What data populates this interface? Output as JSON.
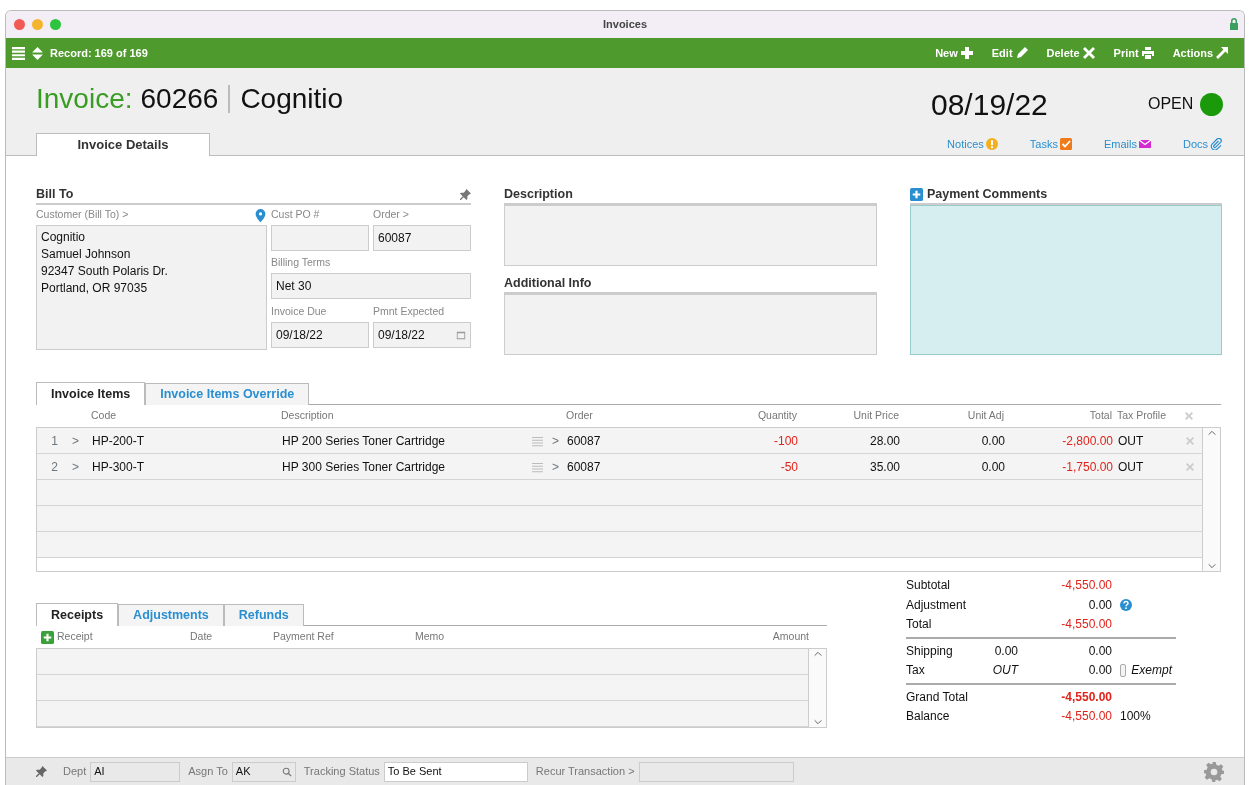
{
  "window": {
    "title": "Invoices"
  },
  "toolbar": {
    "record": "Record: 169 of 169",
    "actions": [
      {
        "label": "New"
      },
      {
        "label": "Edit"
      },
      {
        "label": "Delete"
      },
      {
        "label": "Print"
      },
      {
        "label": "Actions"
      }
    ]
  },
  "header": {
    "label": "Invoice:",
    "number": "60266",
    "customer": "Cognitio",
    "date": "08/19/22",
    "status": "OPEN"
  },
  "main_tabs": [
    {
      "label": "Invoice Details",
      "selected": true
    }
  ],
  "links": [
    {
      "label": "Notices"
    },
    {
      "label": "Tasks"
    },
    {
      "label": "Emails"
    },
    {
      "label": "Docs"
    }
  ],
  "bill_to": {
    "title": "Bill To",
    "customer_label": "Customer (Bill To) >",
    "address": "Cognitio\nSamuel Johnson\n92347 South Polaris Dr.\nPortland, OR 97035",
    "fields": [
      {
        "label": "Cust PO #"
      },
      {
        "label": "Order >",
        "value": "60087"
      },
      {
        "label": "Billing Terms",
        "value": "Net 30"
      },
      {
        "label": "Invoice Due",
        "value": "09/18/22"
      },
      {
        "label": "Pmnt Expected",
        "value": "09/18/22"
      }
    ]
  },
  "description": {
    "title": "Description"
  },
  "additional_info": {
    "title": "Additional Info"
  },
  "payment_comments": {
    "title": "Payment Comments"
  },
  "item_tabs": [
    {
      "label": "Invoice Items",
      "selected": true
    },
    {
      "label": "Invoice Items Override",
      "selected": false
    }
  ],
  "items_table": {
    "columns": [
      "Code",
      "Description",
      "Order",
      "Quantity",
      "Unit Price",
      "Unit Adj",
      "Total",
      "Tax Profile"
    ],
    "rows": [
      {
        "num": "1",
        "code_caret": ">",
        "code": "HP-200-T",
        "order_caret": ">",
        "description": "HP 200 Series Toner Cartridge",
        "order": "60087",
        "quantity": "-100",
        "unit_price": "28.00",
        "unit_adj": "0.00",
        "total": "-2,800.00",
        "tax_profile": "OUT"
      },
      {
        "num": "2",
        "code_caret": ">",
        "code": "HP-300-T",
        "order_caret": ">",
        "description": "HP 300 Series Toner Cartridge",
        "order": "60087",
        "quantity": "-50",
        "unit_price": "35.00",
        "unit_adj": "0.00",
        "total": "-1,750.00",
        "tax_profile": "OUT"
      }
    ]
  },
  "receipt_tabs": [
    {
      "label": "Receipts",
      "selected": true
    },
    {
      "label": "Adjustments",
      "selected": false
    },
    {
      "label": "Refunds",
      "selected": false
    }
  ],
  "receipts_table": {
    "columns": [
      "Receipt",
      "Date",
      "Payment Ref",
      "Memo",
      "Amount"
    ]
  },
  "totals": [
    [
      {
        "label": "Subtotal",
        "value": "-4,550.00",
        "negative": true
      },
      {
        "label": "Adjustment",
        "value": "0.00",
        "negative": false,
        "kind": "help"
      },
      {
        "label": "Total",
        "value": "-4,550.00",
        "negative": true
      }
    ],
    [
      {
        "label": "Shipping",
        "middle": "0.00",
        "value": "0.00",
        "negative": false
      },
      {
        "label": "Tax",
        "middle": "OUT",
        "value": "0.00",
        "negative": false,
        "kind": "exempt",
        "exempt": {
          "label": "Exempt",
          "checked": false
        }
      }
    ],
    [
      {
        "label": "Grand Total",
        "value": "-4,550.00",
        "negative": true,
        "kind": "grand"
      },
      {
        "label": "Balance",
        "value": "-4,550.00",
        "negative": true,
        "kind": "percent",
        "extra": "100%"
      }
    ]
  ],
  "footer": [
    {
      "label": "Dept",
      "value": "AI",
      "kind": "plain"
    },
    {
      "label": "Asgn To",
      "value": "AK",
      "kind": "lookup"
    },
    {
      "label": "Tracking Status",
      "value": "To Be Sent",
      "kind": "editable"
    },
    {
      "label": "Recur Transaction >",
      "kind": "plain"
    }
  ]
}
